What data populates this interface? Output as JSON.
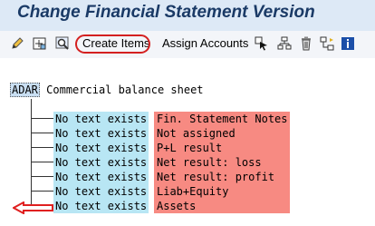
{
  "window": {
    "title": "Change Financial Statement Version"
  },
  "toolbar": {
    "icons_left": [
      "edit-pencil-icon",
      "expand-subtree-icon",
      "find-icon"
    ],
    "create_items_label": "Create Items",
    "assign_accounts_label": "Assign Accounts",
    "icons_right": [
      "select-icon",
      "hierarchy-icon",
      "delete-icon",
      "reassign-icon",
      "info-icon"
    ]
  },
  "tree": {
    "root": {
      "key": "ADAR",
      "label": "Commercial balance sheet"
    },
    "nodes": [
      {
        "description": "No text exists",
        "name": "Fin. Statement Notes"
      },
      {
        "description": "No text exists",
        "name": "Not assigned"
      },
      {
        "description": "No text exists",
        "name": "P+L result"
      },
      {
        "description": "No text exists",
        "name": "Net result: loss"
      },
      {
        "description": "No text exists",
        "name": "Net result: profit"
      },
      {
        "description": "No text exists",
        "name": "Liab+Equity"
      },
      {
        "description": "No text exists",
        "name": "Assets"
      }
    ]
  },
  "colors": {
    "title": "#1a3a66",
    "description_bg": "#b8e6f4",
    "name_bg": "#f78a82",
    "highlight": "#d42020"
  }
}
